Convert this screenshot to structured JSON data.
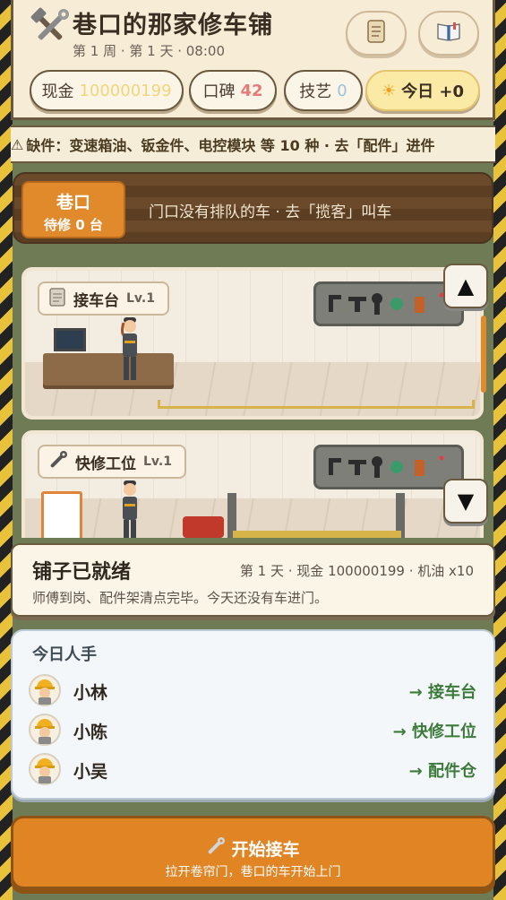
{
  "header": {
    "title": "巷口的那家修车铺",
    "subtitle": "第 1 周 · 第 1 天 · 08:00",
    "logo_icon": "wrench-hammer-icon",
    "scroll_button_icon": "scroll-icon",
    "book_button_icon": "book-icon"
  },
  "stats": {
    "cash_label": "现金",
    "cash_value": "100000199",
    "reputation_label": "口碑",
    "reputation_value": "42",
    "skill_label": "技艺",
    "skill_value": "0",
    "today_label": "今日 +0",
    "today_icon": "sun-icon"
  },
  "warning": {
    "icon": "warning-icon",
    "text": "缺件：变速箱油、钣金件、电控模块 等 10 种 · 去「配件」进件"
  },
  "lane": {
    "name": "巷口",
    "waiting": "待修 0 台",
    "message": "门口没有排队的车 · 去「揽客」叫车"
  },
  "rooms": [
    {
      "name": "接车台",
      "level": "Lv.1",
      "icon": "clipboard-icon"
    },
    {
      "name": "快修工位",
      "level": "Lv.1",
      "icon": "wrench-icon"
    }
  ],
  "scroll": {
    "up": "▲",
    "down": "▼"
  },
  "status": {
    "title": "铺子已就绪",
    "meta": "第 1 天 · 现金 100000199 · 机油 x10",
    "message": "师傅到岗、配件架清点完毕。今天还没有车进门。"
  },
  "staff": {
    "heading": "今日人手",
    "members": [
      {
        "name": "小林",
        "assignment": "→ 接车台",
        "icon": "worker-icon"
      },
      {
        "name": "小陈",
        "assignment": "→ 快修工位",
        "icon": "worker-icon"
      },
      {
        "name": "小吴",
        "assignment": "→ 配件仓",
        "icon": "worker-icon"
      }
    ]
  },
  "start": {
    "label": "开始接车",
    "sub": "拉开卷帘门，巷口的车开始上门",
    "icon": "wrench-icon"
  },
  "colors": {
    "accent_orange": "#e08424",
    "assign_green": "#3c7a3a",
    "panel_cream": "#fbf5e8"
  }
}
